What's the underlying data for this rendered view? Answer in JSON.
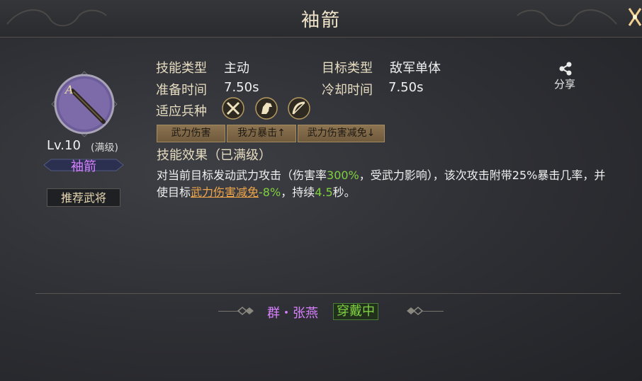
{
  "window": {
    "title": "袖箭"
  },
  "skill": {
    "level": "Lv.10",
    "level_suffix": "(满级)",
    "name": "袖箭",
    "recommend_label": "推荐武将"
  },
  "info": {
    "skill_type_label": "技能类型",
    "skill_type_value": "主动",
    "target_type_label": "目标类型",
    "target_type_value": "敌军单体",
    "prep_time_label": "准备时间",
    "prep_time_value": "7.50s",
    "cooldown_label": "冷却时间",
    "cooldown_value": "7.50s",
    "troop_label": "适应兵种",
    "troop_icons": [
      "crossed-spears-icon",
      "horse-icon",
      "bow-icon"
    ]
  },
  "tags": [
    "武力伤害",
    "我方暴击↑",
    "武力伤害减免↓"
  ],
  "effect": {
    "title": "技能效果（已满级）",
    "p1": "对当前目标发动武力攻击（伤害率",
    "rate": "300%",
    "p2": "，受武力影响），该次攻击附带25%暴击几率，并使目标",
    "link": "武力伤害减免",
    "reduce": "-8%",
    "p3": "，持续",
    "duration": "4.5",
    "p4": "秒。"
  },
  "share": {
    "label": "分享",
    "icon": "share-icon"
  },
  "footer": {
    "owner": "群・张燕",
    "status": "穿戴中"
  },
  "colors": {
    "purple": "#d880ff",
    "green": "#7fd13f",
    "orange": "#f0a64a",
    "gold": "#e6dcc0"
  }
}
